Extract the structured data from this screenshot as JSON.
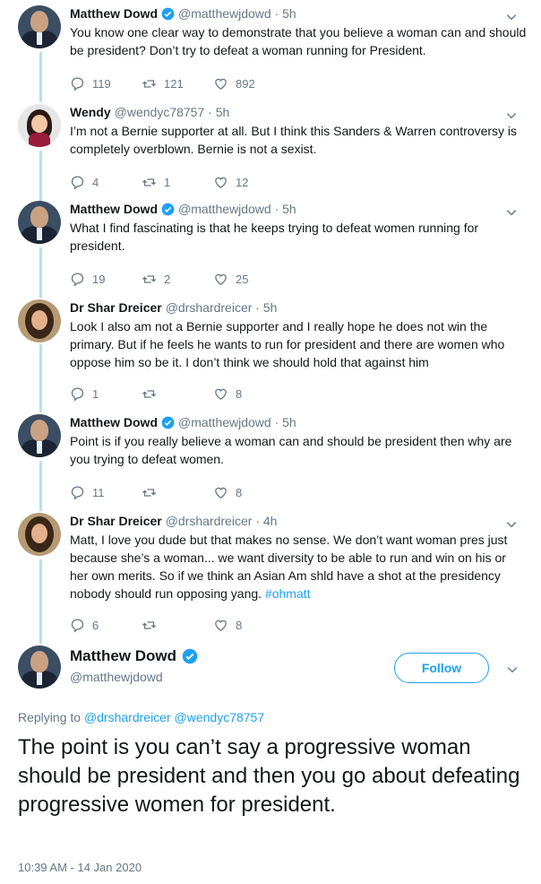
{
  "tweets": [
    {
      "name": "Matthew Dowd",
      "handle": "@matthewjdowd · 5h",
      "text": "You know one clear way to demonstrate that you believe a woman can and should be president?  Don’t try to defeat a woman running for President.",
      "replies": "119",
      "retweets": "121",
      "likes": "892"
    },
    {
      "name": "Wendy",
      "handle": "@wendyc78757 · 5h",
      "text": "I’m not a Bernie supporter at all. But I think this Sanders & Warren controversy is completely overblown. Bernie is not a sexist.",
      "replies": "4",
      "retweets": "1",
      "likes": "12"
    },
    {
      "name": "Matthew Dowd",
      "handle": "@matthewjdowd · 5h",
      "text": "What I find fascinating is that he keeps trying to defeat women running for president.",
      "replies": "19",
      "retweets": "2",
      "likes": "25"
    },
    {
      "name": "Dr Shar Dreicer",
      "handle": "@drshardreicer · 5h",
      "text": "Look I also am not a Bernie supporter and I really hope he does not win the primary. But if he feels he wants to run for president and there are women who oppose him so be it. I don’t think we should hold that against him",
      "replies": "1",
      "retweets": "",
      "likes": "8"
    },
    {
      "name": "Matthew Dowd",
      "handle": "@matthewjdowd · 5h",
      "text": "Point is if you really believe a woman can and should be president then why are you trying to defeat women.",
      "replies": "11",
      "retweets": "",
      "likes": "8"
    },
    {
      "name": "Dr Shar Dreicer",
      "handle": "@drshardreicer · 4h",
      "text": "Matt, I love you dude but that makes no sense. We don’t want woman pres just because she’s a woman... we want diversity to be able to run and win on his or her own merits. So if we think an Asian Am shld have a shot at the presidency nobody should run opposing yang.",
      "hashtag": "#ohmatt",
      "replies": "6",
      "retweets": "",
      "likes": "8"
    }
  ],
  "main_tweet": {
    "name": "Matthew Dowd",
    "handle": "@matthewjdowd",
    "follow_label": "Follow",
    "replying_prefix": "Replying to",
    "replying_to_1": "@drshardreicer",
    "replying_to_2": "@wendyc78757",
    "text": "The point is you can’t say a progressive woman should be president and then you go about defeating progressive women for president.",
    "timestamp": "10:39 AM - 14 Jan 2020"
  },
  "colors": {
    "accent": "#1da1f2",
    "verified": "#1da1f2",
    "thread_line": "#b4e1f6",
    "muted": "#657786"
  }
}
